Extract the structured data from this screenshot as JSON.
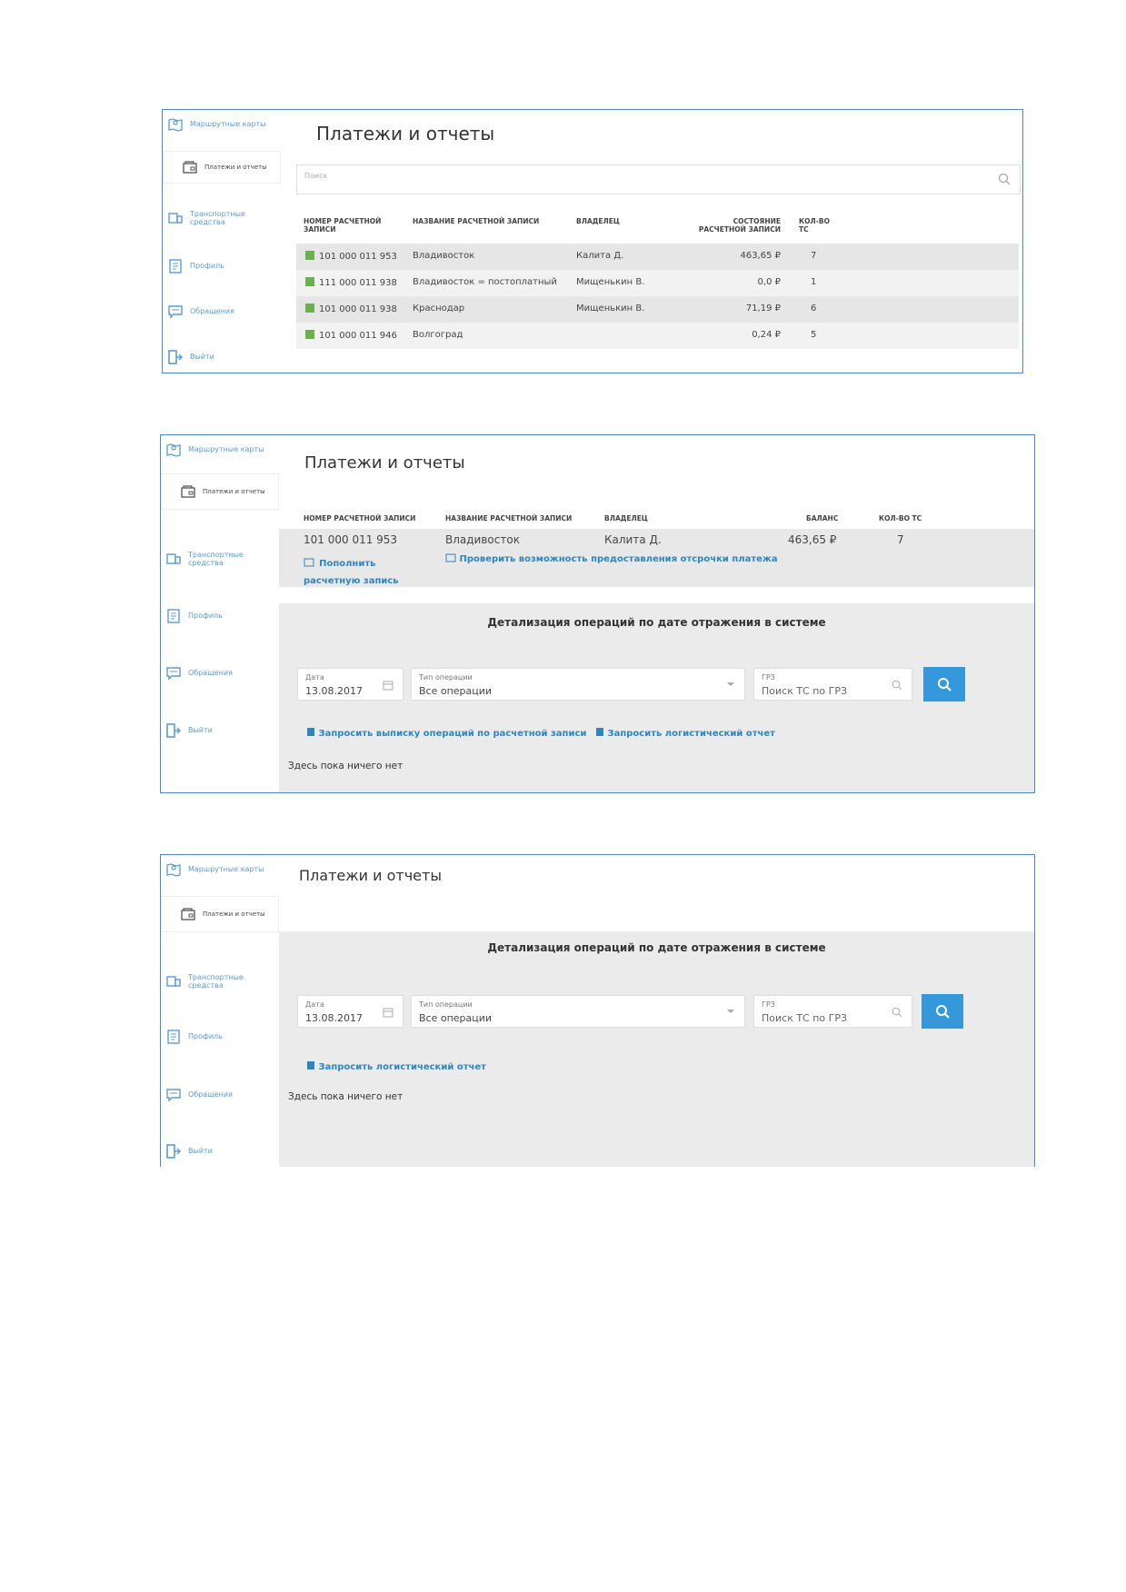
{
  "sidebar": {
    "routes": "Маршрутные карты",
    "payments": "Платежи и отчеты",
    "vehicles": "Транспортные средства",
    "profile": "Профиль",
    "appeals": "Обращения",
    "logout": "Выйти"
  },
  "screen1": {
    "title": "Платежи и отчеты",
    "search_placeholder": "Поиск",
    "headers": {
      "number": "НОМЕР РАСЧЕТНОЙ ЗАПИСИ",
      "name": "НАЗВАНИЕ РАСЧЕТНОЙ ЗАПИСИ",
      "owner": "ВЛАДЕЛЕЦ",
      "state": "СОСТОЯНИЕ РАСЧЕТНОЙ ЗАПИСИ",
      "count": "КОЛ-ВО ТС"
    },
    "rows": [
      {
        "number": "101 000 011 953",
        "name": "Владивосток",
        "owner": "Калита Д.",
        "state": "463,65 ₽",
        "count": "7"
      },
      {
        "number": "111 000 011 938",
        "name": "Владивосток = постоплатный",
        "owner": "Мищенькин В.",
        "state": "0,0 ₽",
        "count": "1"
      },
      {
        "number": "101 000 011 938",
        "name": "Краснодар",
        "owner": "Мищенькин В.",
        "state": "71,19 ₽",
        "count": "6"
      },
      {
        "number": "101 000 011 946",
        "name": "Волгоград",
        "owner": "",
        "state": "0,24 ₽",
        "count": "5"
      }
    ]
  },
  "screen2": {
    "title": "Платежи и отчеты",
    "headers": {
      "number": "НОМЕР РАСЧЕТНОЙ ЗАПИСИ",
      "name": "НАЗВАНИЕ РАСЧЕТНОЙ ЗАПИСИ",
      "owner": "ВЛАДЕЛЕЦ",
      "balance": "БАЛАНС",
      "count": "КОЛ-ВО ТС"
    },
    "row": {
      "number": "101 000 011 953",
      "name": "Владивосток",
      "owner": "Калита Д.",
      "balance": "463,65 ₽",
      "count": "7"
    },
    "topup_link": "Пополнить расчетную запись",
    "deferral_link": "Проверить возможность предоставления отсрочки платежа",
    "section_title": "Детализация операций по дате отражения в системе",
    "date_label": "Дата",
    "date_value": "13.08.2017",
    "type_label": "Тип операции",
    "type_value": "Все операции",
    "grz_label": "ГРЗ",
    "grz_placeholder": "Поиск ТС по ГРЗ",
    "statement_link": "Запросить выписку операций по расчетной записи",
    "logistic_link": "Запросить логистический отчет",
    "empty_text": "Здесь пока ничего нет"
  },
  "screen3": {
    "title": "Платежи и отчеты",
    "section_title": "Детализация операций по дате отражения в системе",
    "date_label": "Дата",
    "date_value": "13.08.2017",
    "type_label": "Тип операции",
    "type_value": "Все операции",
    "grz_label": "ГРЗ",
    "grz_placeholder": "Поиск ТС по ГРЗ",
    "logistic_link": "Запросить логистический отчет",
    "empty_text": "Здесь пока ничего нет"
  },
  "colors": {
    "accent": "#3498db",
    "link": "#2e86c1",
    "badge": "#6ab04c",
    "frame": "#4a86c8"
  }
}
